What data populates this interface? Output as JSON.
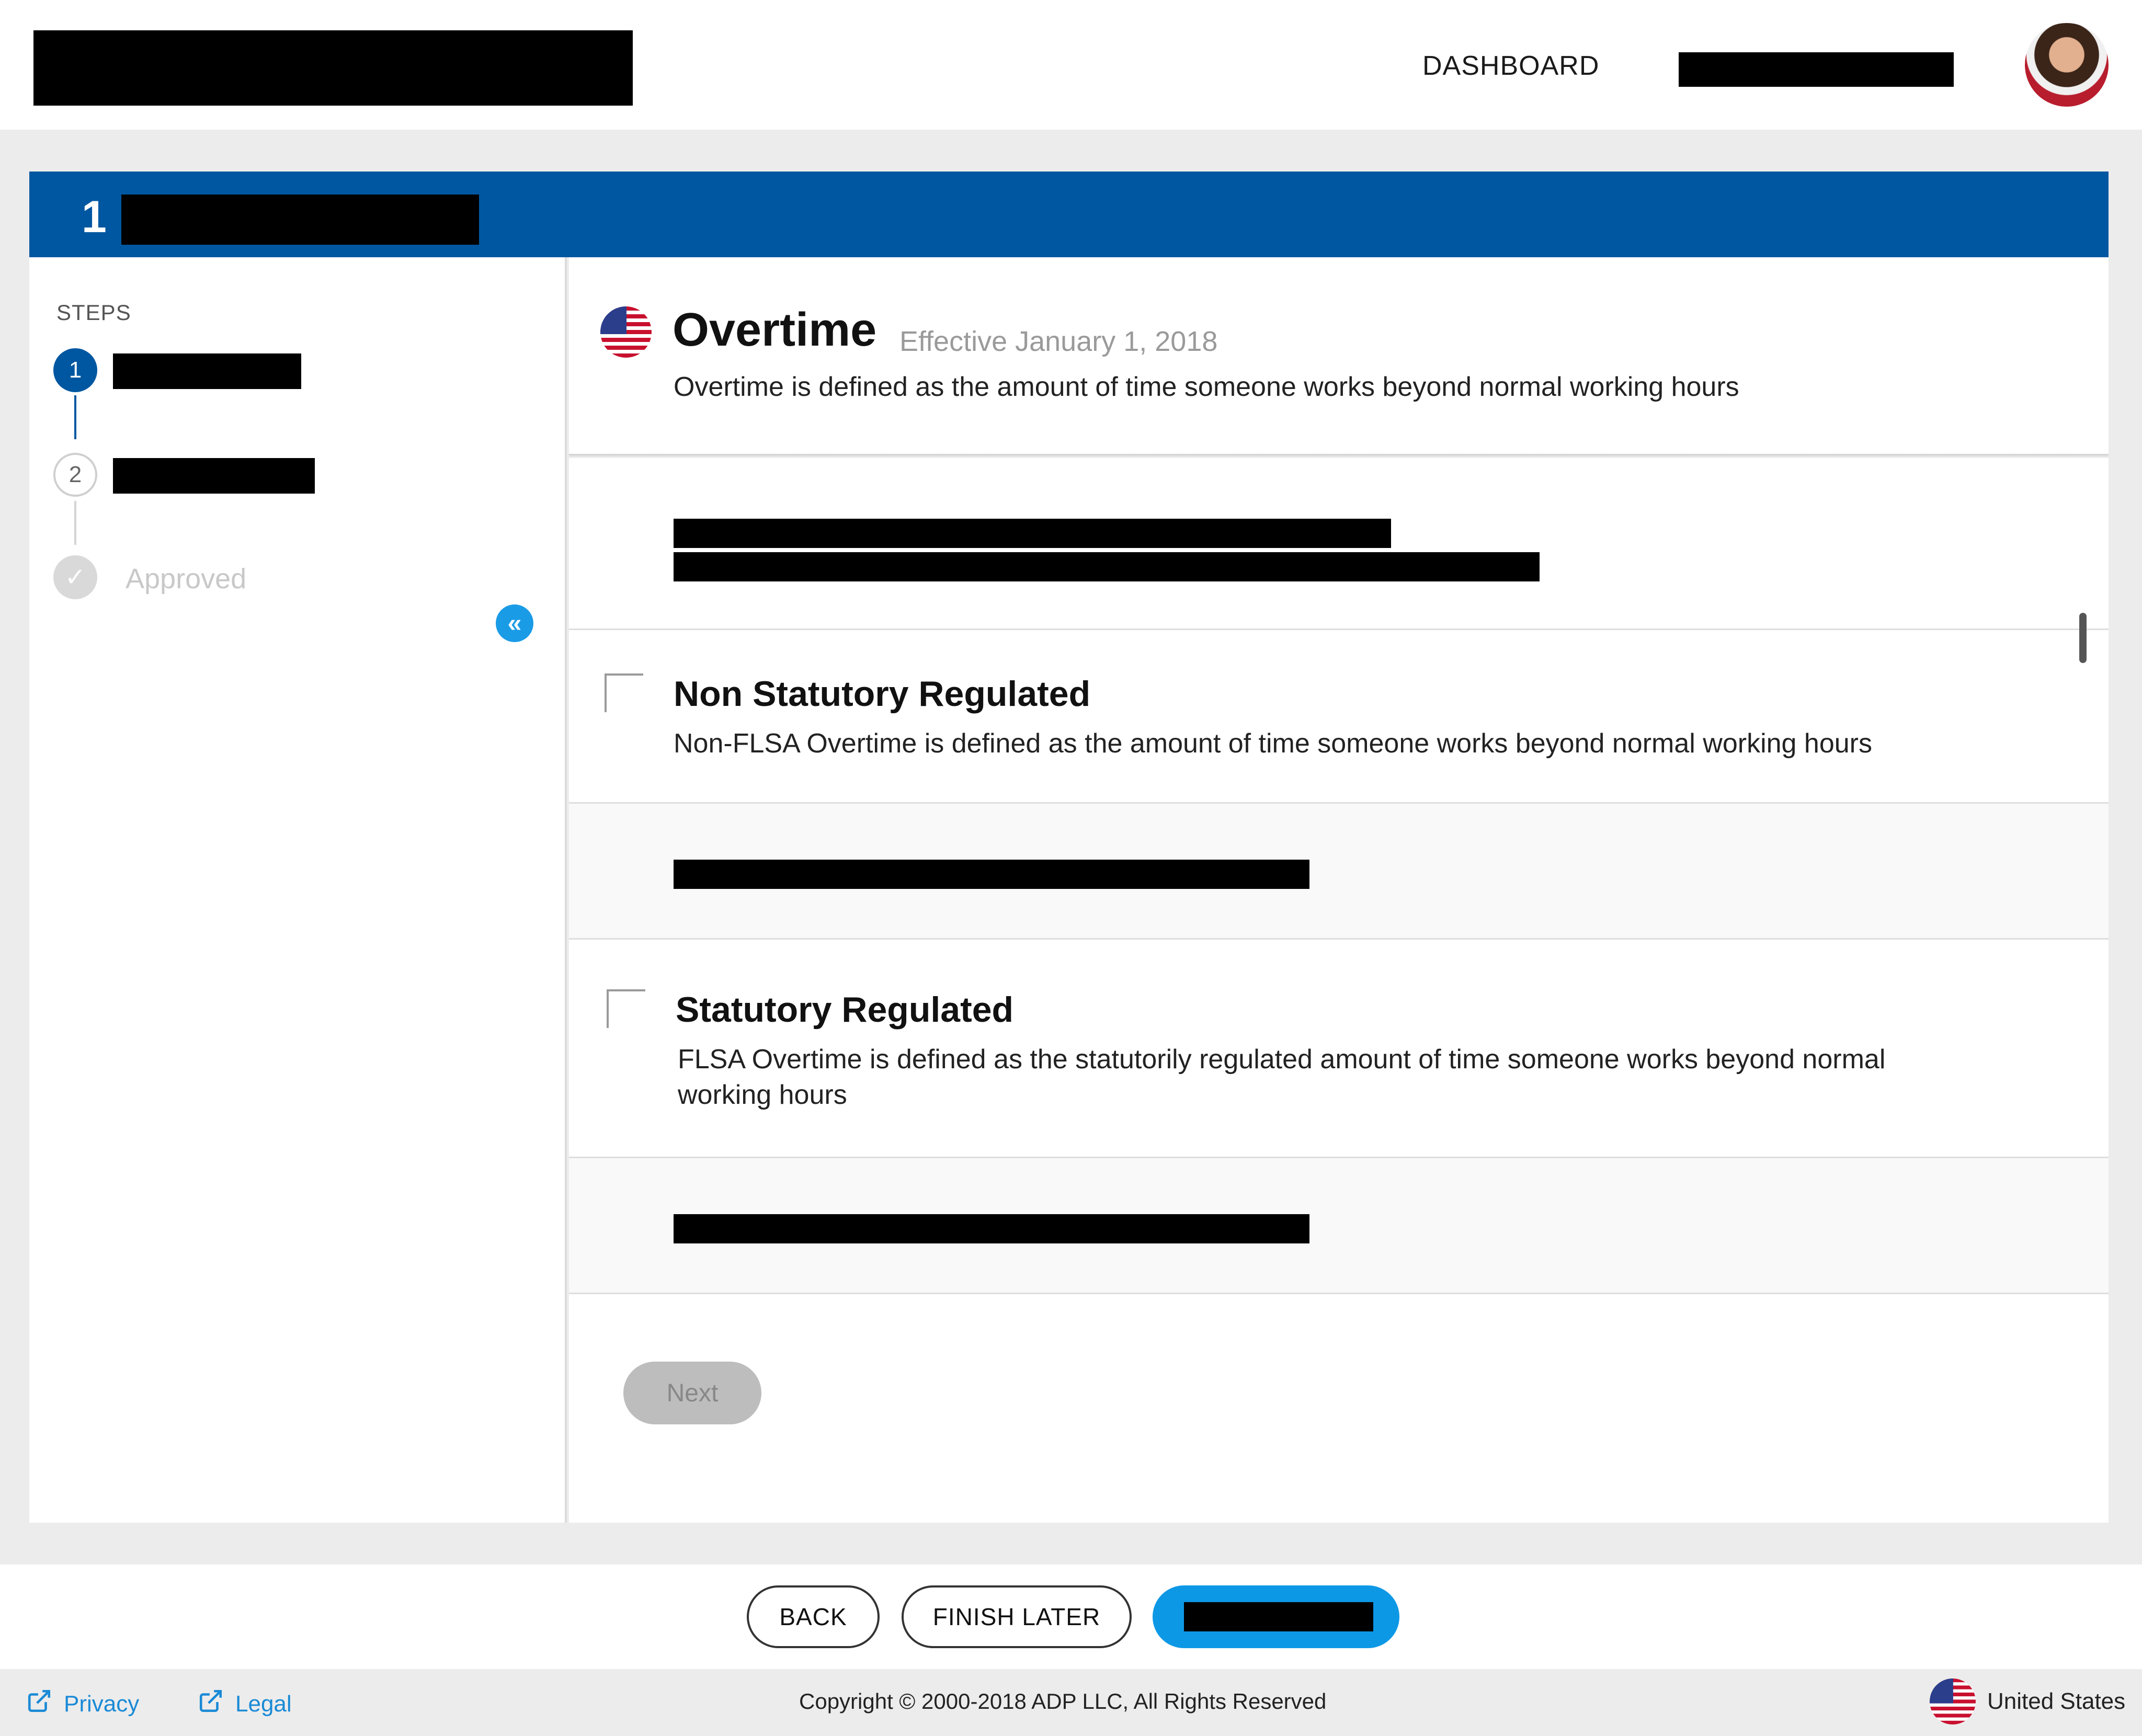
{
  "header": {
    "nav_dashboard": "DASHBOARD"
  },
  "titlebar": {
    "step_number": "1"
  },
  "sidebar": {
    "steps_label": "STEPS",
    "steps": [
      {
        "number": "1",
        "state": "active"
      },
      {
        "number": "2",
        "state": "pending"
      },
      {
        "label": "Approved",
        "state": "disabled"
      }
    ]
  },
  "overtime": {
    "title": "Overtime",
    "effective": "Effective January 1, 2018",
    "description": "Overtime is defined as the amount of time someone works beyond normal working hours"
  },
  "options": [
    {
      "title": "Non Statutory Regulated",
      "description": "Non-FLSA Overtime is defined as the amount of time someone works beyond normal working hours",
      "checked": false
    },
    {
      "title": "Statutory Regulated",
      "description": "FLSA Overtime is defined as the statutorily regulated amount of time someone works beyond normal working hours",
      "checked": false
    }
  ],
  "buttons": {
    "next": "Next",
    "back": "BACK",
    "finish_later": "FINISH LATER"
  },
  "footer": {
    "privacy": "Privacy",
    "legal": "Legal",
    "copyright": "Copyright © 2000-2018 ADP LLC, All Rights Reserved",
    "country": "United States"
  },
  "icons": {
    "collapse": "double-chevron-left-icon",
    "external_link": "external-link-icon",
    "flag": "us-flag-icon",
    "check": "check-icon"
  },
  "colors": {
    "brand_blue": "#0057a1",
    "accent_blue": "#0d98e6",
    "link_blue": "#1a8ad6"
  }
}
